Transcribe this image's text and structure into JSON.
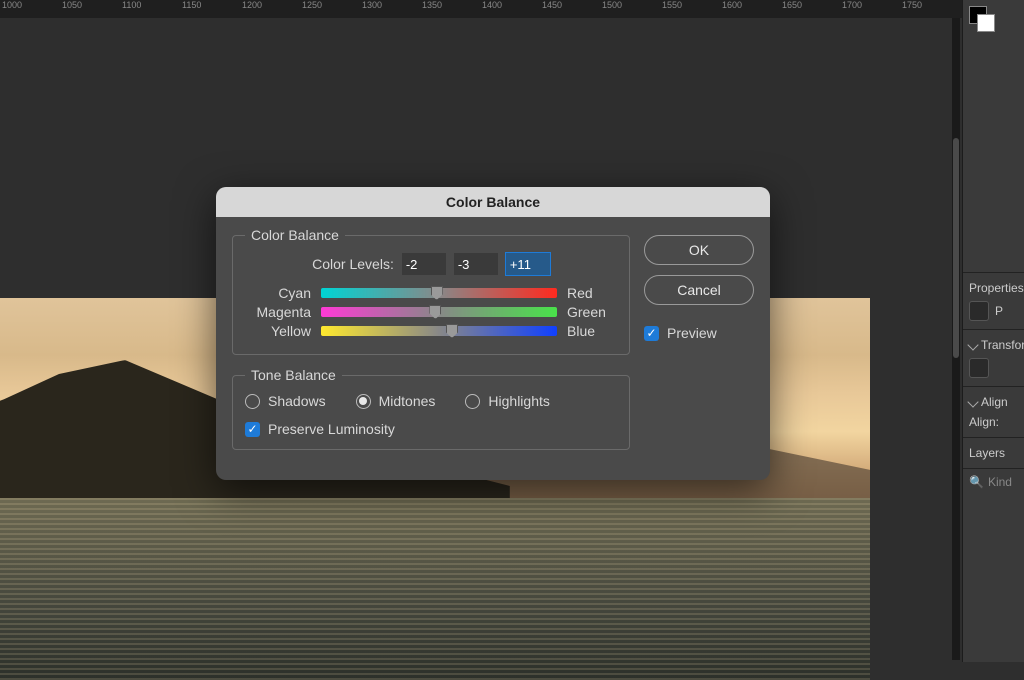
{
  "ruler_marks": [
    "1000",
    "1050",
    "1100",
    "1150",
    "1200",
    "1250",
    "1300",
    "1350",
    "1400",
    "1450",
    "1500",
    "1550",
    "1600",
    "1650",
    "1700",
    "1750"
  ],
  "dialog": {
    "title": "Color Balance",
    "color_balance_legend": "Color Balance",
    "levels_label": "Color Levels:",
    "levels": {
      "cyan_red": "-2",
      "magenta_green": "-3",
      "yellow_blue": "+11"
    },
    "slider_positions_pct": {
      "cyan_red": 49,
      "magenta_green": 48.5,
      "yellow_blue": 55.5
    },
    "labels": {
      "cyan": "Cyan",
      "red": "Red",
      "magenta": "Magenta",
      "green": "Green",
      "yellow": "Yellow",
      "blue": "Blue"
    },
    "tone_legend": "Tone Balance",
    "tones": {
      "shadows": "Shadows",
      "midtones": "Midtones",
      "highlights": "Highlights",
      "selected": "midtones"
    },
    "preserve_luminosity": {
      "label": "Preserve Luminosity",
      "checked": true
    },
    "buttons": {
      "ok": "OK",
      "cancel": "Cancel"
    },
    "preview": {
      "label": "Preview",
      "checked": true
    }
  },
  "side_panel": {
    "properties": "Properties",
    "transform": "Transform",
    "align": "Align",
    "align_label": "Align:",
    "layers": "Layers",
    "search_placeholder": "Kind"
  }
}
